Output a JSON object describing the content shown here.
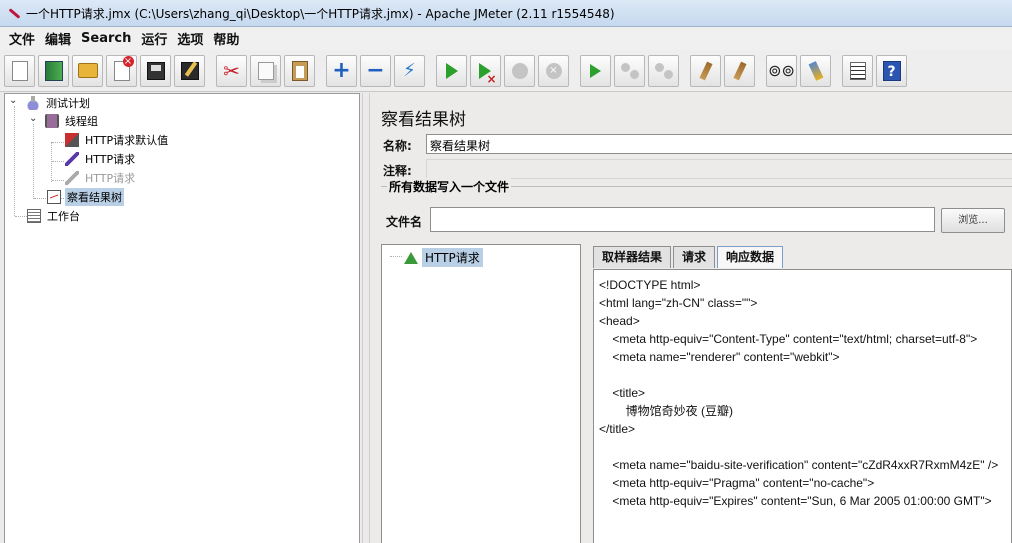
{
  "window": {
    "title": "一个HTTP请求.jmx (C:\\Users\\zhang_qi\\Desktop\\一个HTTP请求.jmx) - Apache JMeter (2.11 r1554548)"
  },
  "menubar": {
    "items": [
      {
        "label": "文件"
      },
      {
        "label": "编辑"
      },
      {
        "label": "Search"
      },
      {
        "label": "运行"
      },
      {
        "label": "选项"
      },
      {
        "label": "帮助"
      }
    ]
  },
  "toolbar": {
    "buttons": [
      {
        "icon": "new-doc-icon"
      },
      {
        "icon": "templates-icon"
      },
      {
        "icon": "open-folder-icon"
      },
      {
        "icon": "close-doc-icon"
      },
      {
        "icon": "save-icon"
      },
      {
        "icon": "save-as-icon"
      },
      {
        "icon": "cut-icon"
      },
      {
        "icon": "copy-icon"
      },
      {
        "icon": "paste-icon"
      },
      {
        "icon": "expand-icon"
      },
      {
        "icon": "collapse-icon"
      },
      {
        "icon": "toggle-icon"
      },
      {
        "icon": "start-icon"
      },
      {
        "icon": "start-no-pause-icon"
      },
      {
        "icon": "stop-icon"
      },
      {
        "icon": "shutdown-icon"
      },
      {
        "icon": "remote-start-icon"
      },
      {
        "icon": "remote-stop-icon"
      },
      {
        "icon": "remote-shutdown-icon"
      },
      {
        "icon": "clear-icon"
      },
      {
        "icon": "clear-all-icon"
      },
      {
        "icon": "search-binoculars-icon"
      },
      {
        "icon": "reset-search-icon"
      },
      {
        "icon": "function-helper-icon"
      },
      {
        "icon": "help-icon"
      }
    ]
  },
  "tree": {
    "items": [
      {
        "label": "测试计划"
      },
      {
        "label": "线程组"
      },
      {
        "label": "HTTP请求默认值"
      },
      {
        "label": "HTTP请求"
      },
      {
        "label": "HTTP请求"
      },
      {
        "label": "察看结果树"
      },
      {
        "label": "工作台"
      }
    ],
    "selected_index": 5
  },
  "panel": {
    "title": "察看结果树",
    "name_label": "名称:",
    "name_value": "察看结果树",
    "comment_label": "注释:",
    "comment_value": "",
    "file_section_title": "所有数据写入一个文件",
    "filename_label": "文件名",
    "filename_value": "",
    "browse_label": "浏览..."
  },
  "results": {
    "sample_node": "HTTP请求",
    "tabs": [
      {
        "label": "取样器结果"
      },
      {
        "label": "请求"
      },
      {
        "label": "响应数据"
      }
    ],
    "active_tab": 2,
    "response_lines": [
      "<!DOCTYPE html>",
      "<html lang=\"zh-CN\" class=\"\">",
      "<head>",
      "    <meta http-equiv=\"Content-Type\" content=\"text/html; charset=utf-8\">",
      "    <meta name=\"renderer\" content=\"webkit\">",
      "",
      "    <title>",
      "        博物馆奇妙夜 (豆瓣)",
      "</title>",
      "",
      "    <meta name=\"baidu-site-verification\" content=\"cZdR4xxR7RxmM4zE\" />",
      "    <meta http-equiv=\"Pragma\" content=\"no-cache\">",
      "    <meta http-equiv=\"Expires\" content=\"Sun, 6 Mar 2005 01:00:00 GMT\">"
    ]
  }
}
